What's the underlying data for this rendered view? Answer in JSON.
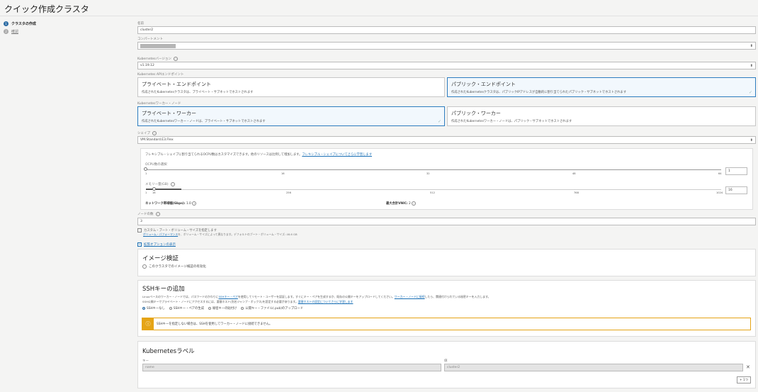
{
  "page_title": "クイック作成クラスタ",
  "steps": [
    {
      "num": "1",
      "label": "クラスタの作成",
      "active": true
    },
    {
      "num": "2",
      "label": "確認",
      "active": false
    }
  ],
  "name": {
    "label": "名前",
    "value": "cluster2"
  },
  "compartment": {
    "label": "コンパートメント"
  },
  "k8s_version": {
    "label": "Kubernetesバージョン",
    "value": "v1.19.12"
  },
  "api_endpoint": {
    "label": "Kubernetes APIエンドポイント",
    "private": {
      "title": "プライベート・エンドポイント",
      "desc": "作成されたKubernetesクラスタは、プライベート・サブネットでホストされます"
    },
    "public": {
      "title": "パブリック・エンドポイント",
      "desc": "作成されたKubernetesクラスタは、パブリックIPアドレスが自動的に割り当てられたパブリック・サブネットでホストされます"
    }
  },
  "worker_nodes": {
    "label": "Kubernetesワーカー・ノード",
    "private": {
      "title": "プライベート・ワーカー",
      "desc": "作成されたKubernetesワーカー・ノードは、プライベート・サブネットでホストされます"
    },
    "public": {
      "title": "パブリック・ワーカー",
      "desc": "作成されたKubernetesワーカー・ノードは、パブリック・サブネットでホストされます"
    }
  },
  "shape": {
    "label": "シェイプ",
    "value": "VM.Standard.E3.Flex",
    "info_text": "フレキシブル・シェイプに割り当てられるOCPU数はカスタマイズできます。他のリソースは比例して増加します。",
    "info_link": "フレキシブル・シェイプについてさらに学習します",
    "ocpu": {
      "label": "OCPU数の選択",
      "ticks": [
        "1",
        "16",
        "32",
        "48",
        "64"
      ],
      "value": "1",
      "level": 0
    },
    "memory": {
      "label": "メモリー量(GB)",
      "ticks": [
        "1",
        "16",
        "256",
        "512",
        "768",
        "1024"
      ],
      "value": "16",
      "level": 0.015
    },
    "network_bw": {
      "label": "ネットワーク帯域幅(Gbps):",
      "value": "1.0"
    },
    "max_vnic": {
      "label": "最大合計VNIC:",
      "value": "2"
    }
  },
  "node_count": {
    "label": "ノードの数",
    "value": "3"
  },
  "boot_volume": {
    "label": "カスタム・ブート・ボリューム・サイズを指定します",
    "link": "ボリューム・パフォーマンス",
    "desc": "を、ボリューム・サイズによって異なります。デフォルトのブート・ボリューム・サイズ: 46.6 GB"
  },
  "advanced_link": "拡張オプションの表示",
  "image_verify": {
    "title": "イメージ検証",
    "checkbox": "このクラスタでのイメージ検証の有効化"
  },
  "ssh": {
    "title": "SSHキーの追加",
    "desc1a": "Linuxベースのワーカー・ノードでは、パスワードのかわりに",
    "desc1link": "SSHキー・ペア",
    "desc1b": "を使用してリモート・ユーザーを認証します。すぐにキー・ペアを生成するか、既存の公開キーをアップロードしてください。",
    "desc1link2": "ワーカー・ノードに接続",
    "desc1c": "したら、関連付けられている秘密キーを入力します。",
    "desc2a": "SSH公開キーでプライベート・ノードにアクセスするには、要塞ホスト(別名ジャンプ・ボックス)を設定する必要があります。",
    "desc2link": "要塞ホストの設定についてさらに学習します",
    "options": [
      "SSHキーなし",
      "SSHキー・ペアの生成",
      "秘密キーの貼付け",
      "公開キー・ファイル(.pub)のアップロード"
    ],
    "selected": 0,
    "warning": "SSHキーを指定しない場合は、SSHを使用してワーカー・ノードに接続できません。"
  },
  "labels": {
    "title": "Kubernetesラベル",
    "key_label": "キー",
    "value_label": "値",
    "key_value": "name",
    "value_value": "cluster2",
    "add_button": "+ 1つ"
  },
  "colors": {
    "accent": "#2e7dbf",
    "warning": "#e5a416",
    "link": "#1a6fb5"
  }
}
